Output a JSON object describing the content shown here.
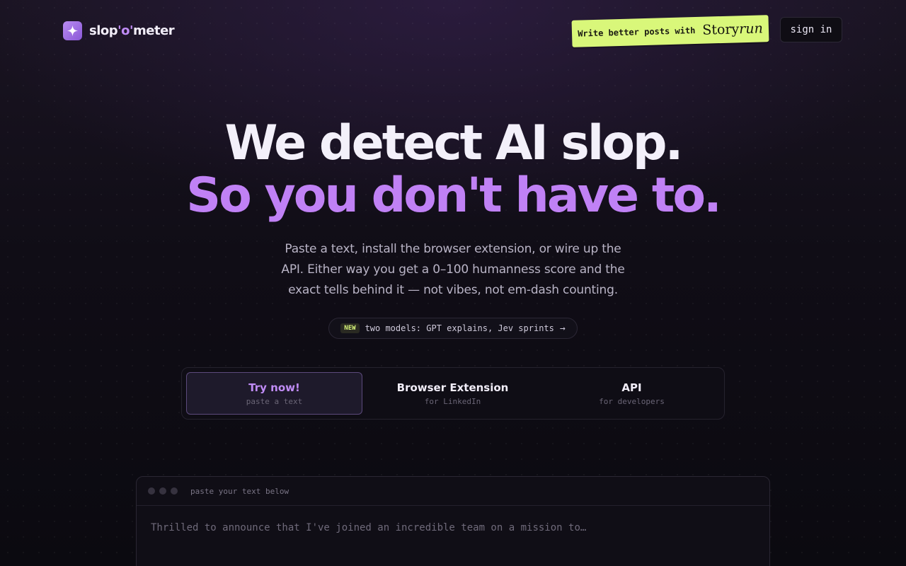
{
  "header": {
    "logo_pre": "slop",
    "logo_mid": "'o'",
    "logo_post": "meter",
    "promo_text": "Write better posts with",
    "promo_brand_a": "Story",
    "promo_brand_b": "run",
    "signin_label": "sign in",
    "logo_icon": "sparkle-icon"
  },
  "hero": {
    "line1": "We detect AI slop.",
    "line2": "So you don't have to.",
    "subtitle": "Paste a text, install the browser extension, or wire up the API. Either way you get a 0–100 humanness score and the exact tells behind it — not vibes, not em-dash counting."
  },
  "announcement": {
    "badge": "NEW",
    "text": "two models: GPT explains, Jev sprints",
    "arrow": "→"
  },
  "tabs": [
    {
      "title": "Try now!",
      "sub": "paste a text",
      "active": true
    },
    {
      "title": "Browser Extension",
      "sub": "for LinkedIn",
      "active": false
    },
    {
      "title": "API",
      "sub": "for developers",
      "active": false
    }
  ],
  "editor": {
    "label": "paste your text below",
    "placeholder": "Thrilled to announce that I've joined an incredible team on a mission to…"
  },
  "colors": {
    "accent": "#c081f5",
    "promo_bg": "#d9f77a",
    "background": "#0b0a10"
  }
}
